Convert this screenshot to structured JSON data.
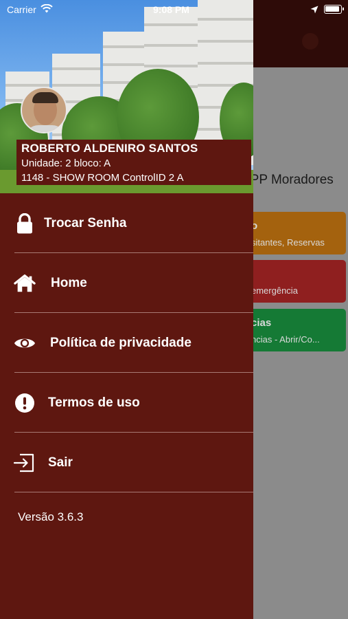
{
  "status_bar": {
    "carrier": "Carrier",
    "time": "9:08 PM"
  },
  "background": {
    "app_title": "APP Moradores",
    "cards": [
      {
        "title": "o",
        "subtitle": "sitantes, Reservas",
        "color": "#a4620e"
      },
      {
        "title": "",
        "subtitle": "emergência",
        "color": "#8f1f1f"
      },
      {
        "title": "cias",
        "subtitle": "ncias - Abrir/Co...",
        "color": "#157a35"
      }
    ]
  },
  "drawer": {
    "user": {
      "name": "ROBERTO ALDENIRO SANTOS",
      "unit": "Unidade: 2 bloco: A",
      "condo": "1148 - SHOW ROOM ControlID 2 A"
    },
    "menu": [
      {
        "label": "Trocar Senha",
        "icon": "lock-icon"
      },
      {
        "label": "Home",
        "icon": "home-icon"
      },
      {
        "label": "Política de privacidade",
        "icon": "eye-icon"
      },
      {
        "label": "Termos de uso",
        "icon": "exclamation-circle-icon"
      },
      {
        "label": "Sair",
        "icon": "sign-out-icon"
      }
    ],
    "version": "Versão 3.6.3"
  },
  "colors": {
    "drawer_bg": "#5e1710",
    "divider": "#a87a74",
    "header_bg": "#2e0b08"
  }
}
